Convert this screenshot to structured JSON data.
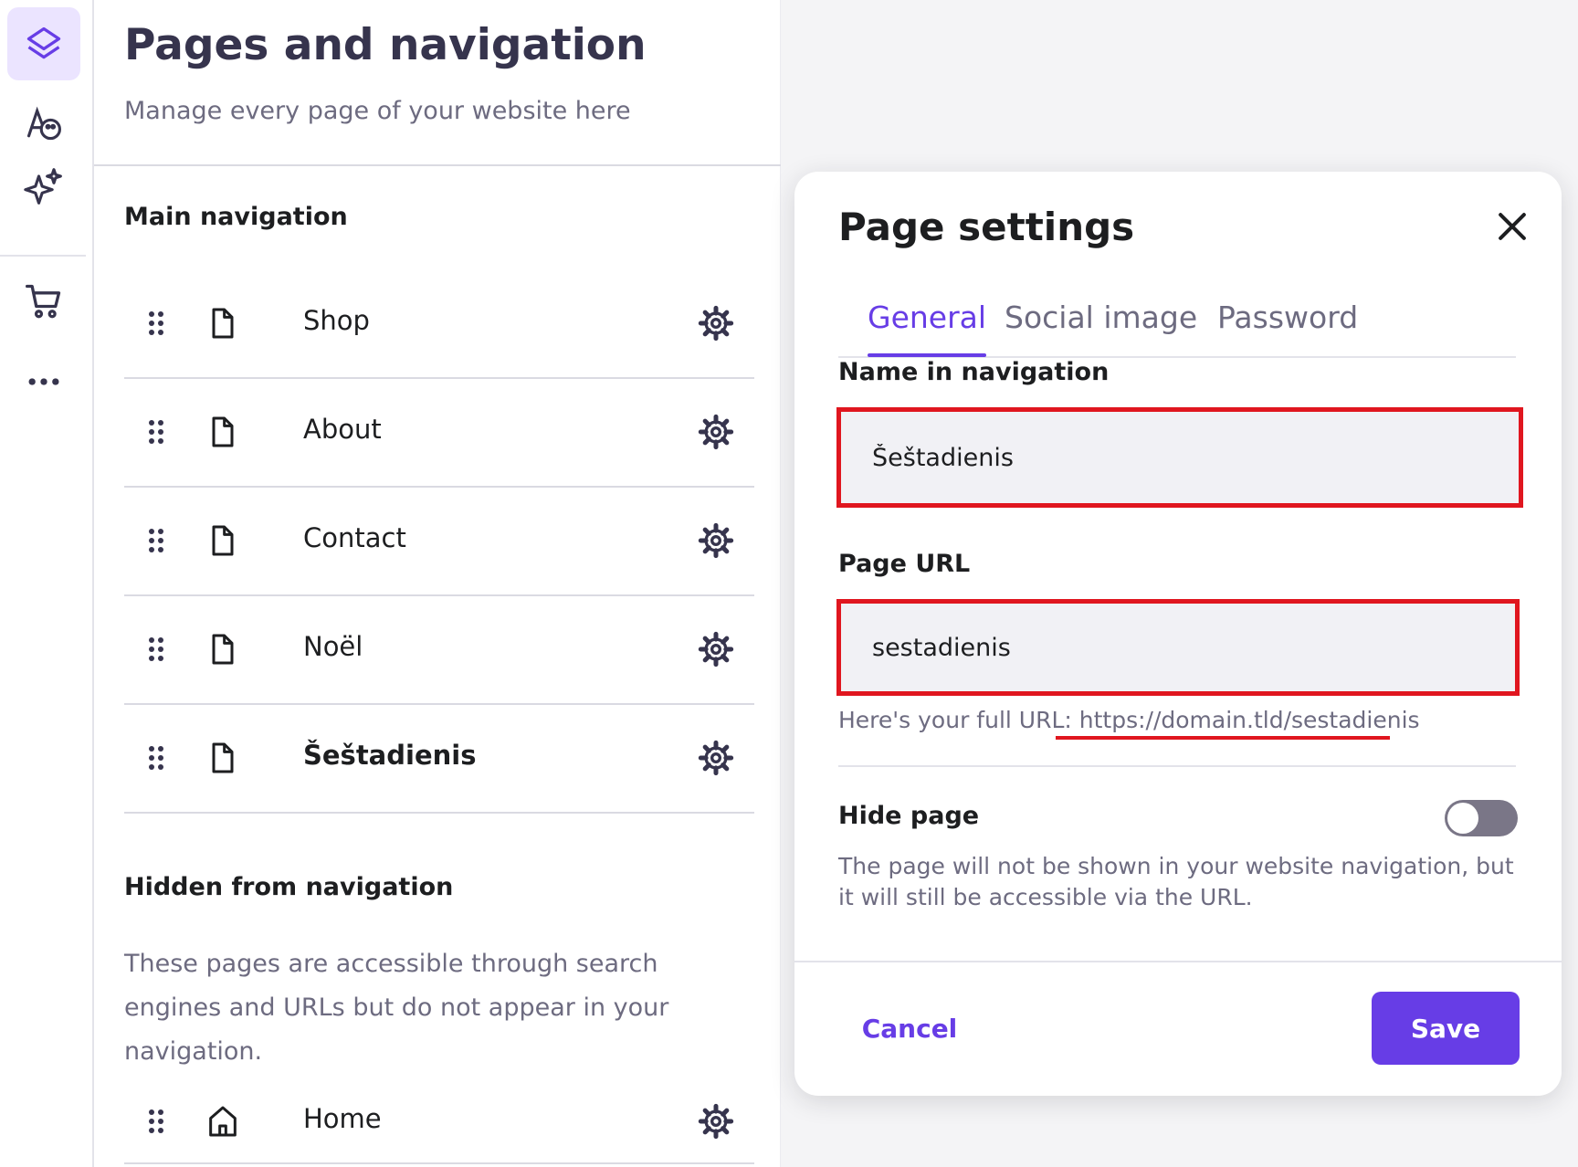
{
  "colors": {
    "accent": "#673de6",
    "accent_light": "#ebe4ff",
    "heading": "#36344d",
    "highlight_red": "#e0161f",
    "toggle_off": "#7a7687"
  },
  "sidebar_rail": {
    "items": [
      {
        "icon": "layers-icon",
        "active": true
      },
      {
        "icon": "design-palette-icon",
        "active": false
      },
      {
        "icon": "sparkles-icon",
        "active": false
      },
      {
        "icon": "cart-icon",
        "active": false
      },
      {
        "icon": "more-dots-icon",
        "active": false
      }
    ]
  },
  "header": {
    "title": "Pages and navigation",
    "subtitle": "Manage every page of your website here"
  },
  "main_navigation": {
    "heading": "Main navigation",
    "items": [
      {
        "label": "Shop",
        "icon": "page-icon"
      },
      {
        "label": "About",
        "icon": "page-icon"
      },
      {
        "label": "Contact",
        "icon": "page-icon"
      },
      {
        "label": "Noël",
        "icon": "page-icon"
      },
      {
        "label": "Šeštadienis",
        "icon": "page-icon",
        "selected": true
      }
    ]
  },
  "hidden_navigation": {
    "heading": "Hidden from navigation",
    "description": "These pages are accessible through search engines and URLs but do not appear in your navigation.",
    "items": [
      {
        "label": "Home",
        "icon": "home-icon"
      }
    ]
  },
  "modal": {
    "title": "Page settings",
    "tabs": [
      {
        "label": "General",
        "active": true
      },
      {
        "label": "Social image",
        "active": false
      },
      {
        "label": "Password",
        "active": false
      }
    ],
    "name_label": "Name in navigation",
    "name_value": "Šeštadienis",
    "url_label": "Page URL",
    "url_value": "sestadienis",
    "full_url_prefix": "Here's your full URL:",
    "full_url": "https://domain.tld/sestadienis",
    "hide_label": "Hide page",
    "hide_enabled": false,
    "hide_description": "The page will not be shown in your website navigation, but it will still be accessible via the URL.",
    "cancel_label": "Cancel",
    "save_label": "Save"
  }
}
